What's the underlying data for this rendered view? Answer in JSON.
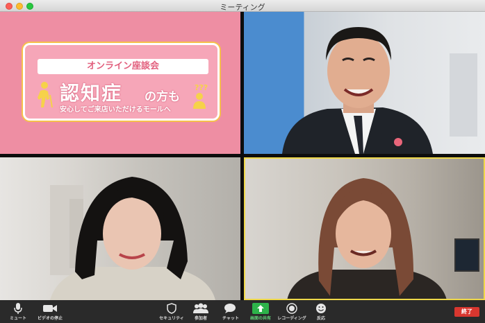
{
  "window": {
    "title": "ミーティング"
  },
  "slide": {
    "banner": "オンライン座談会",
    "headline_kanji": "認知症",
    "headline_suffix": "の方も",
    "tagline": "安心してご来店いただけるモールへ",
    "question_marks": "???"
  },
  "toolbar": {
    "left": [
      {
        "label": "ミュート",
        "icon": "microphone-icon"
      },
      {
        "label": "ビデオの停止",
        "icon": "video-camera-icon"
      }
    ],
    "center": [
      {
        "label": "セキュリティ",
        "icon": "shield-icon"
      },
      {
        "label": "参加者",
        "icon": "participants-icon"
      },
      {
        "label": "チャット",
        "icon": "chat-bubble-icon"
      },
      {
        "label": "画面の共有",
        "icon": "share-screen-icon"
      },
      {
        "label": "レコーディング",
        "icon": "record-icon"
      },
      {
        "label": "反応",
        "icon": "smiley-icon"
      }
    ],
    "end_label": "終了"
  },
  "colors": {
    "slide_bg": "#ee8ea3",
    "share_green": "#2db34a",
    "end_red": "#d9372f",
    "active_speaker": "#f0d94a"
  }
}
